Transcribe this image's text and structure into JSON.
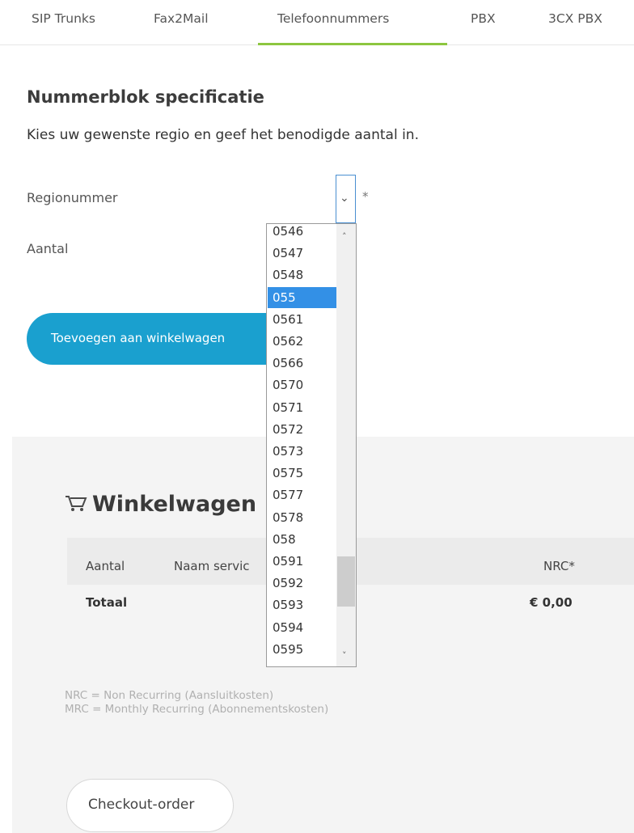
{
  "tabs": [
    {
      "label": "SIP Trunks"
    },
    {
      "label": "Fax2Mail"
    },
    {
      "label": "Telefoonnummers",
      "active": true
    },
    {
      "label": "PBX"
    },
    {
      "label": "3CX PBX"
    }
  ],
  "form": {
    "section_title": "Nummerblok specificatie",
    "intro": "Kies uw gewenste regio en geef het benodigde aantal in.",
    "region_label": "Regionummer",
    "required_marker": "*",
    "quantity_label": "Aantal",
    "add_button_label": "Toevoegen aan winkelwagen"
  },
  "dropdown": {
    "selected": "055",
    "options": [
      "0546",
      "0547",
      "0548",
      "055",
      "0561",
      "0562",
      "0566",
      "0570",
      "0571",
      "0572",
      "0573",
      "0575",
      "0577",
      "0578",
      "058",
      "0591",
      "0592",
      "0593",
      "0594",
      "0595"
    ]
  },
  "cart": {
    "title": "Winkelwagen",
    "columns": [
      "Aantal",
      "Naam servic",
      "NRC*"
    ],
    "total_label": "Totaal",
    "total_value": "€ 0,00",
    "legend_lines": [
      "NRC = Non Recurring (Aansluitkosten)",
      "MRC = Monthly Recurring (Abonnementskosten)"
    ],
    "checkout_label": "Checkout-order"
  },
  "colors": {
    "accent": "#1aa0cf",
    "tab_active_underline": "#8dc63f",
    "selection": "#3390e6"
  },
  "icons": {
    "chevron": "chevron-down-icon",
    "cart": "shopping-cart-icon"
  }
}
